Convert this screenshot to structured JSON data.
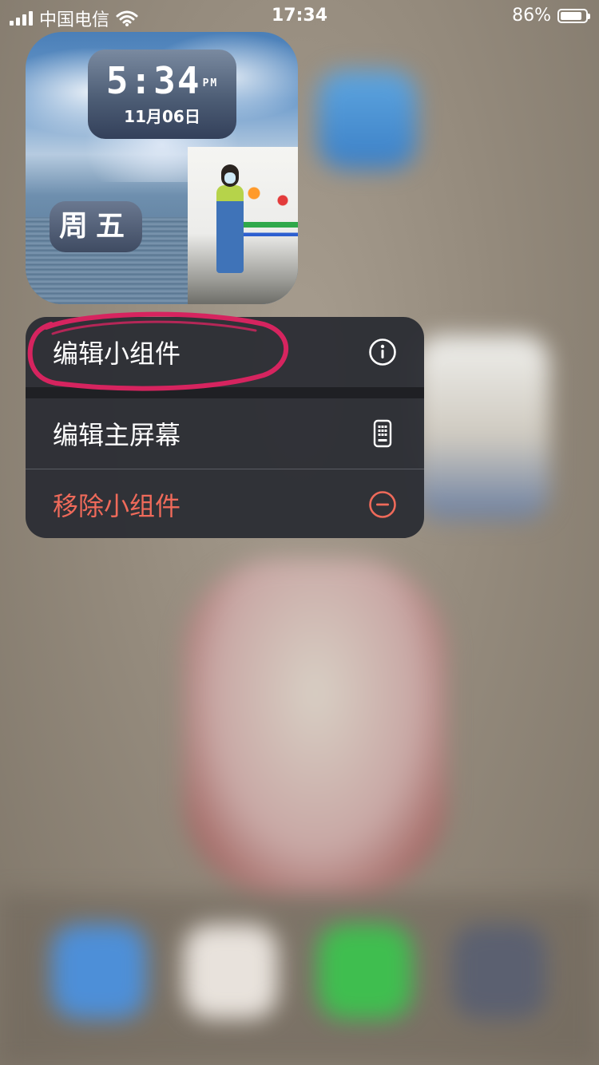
{
  "status_bar": {
    "carrier": "中国电信",
    "time": "17:34",
    "battery": "86%",
    "battery_level": 0.86
  },
  "widget": {
    "time": "5:34",
    "ampm": "PM",
    "date": "11月06日",
    "day": "周五"
  },
  "menu": {
    "items": [
      {
        "label": "编辑小组件",
        "icon": "info-icon"
      },
      {
        "label": "编辑主屏幕",
        "icon": "phone-grid-icon"
      },
      {
        "label": "移除小组件",
        "icon": "minus-circle-icon",
        "color": "#ef6a5a"
      }
    ]
  },
  "annotation": {
    "color": "#d6245f"
  }
}
